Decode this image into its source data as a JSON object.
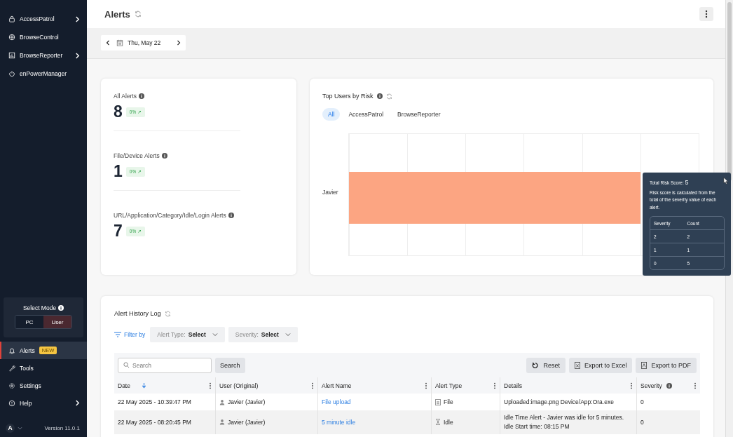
{
  "sidebar": {
    "top_items": [
      {
        "label": "AccessPatrol",
        "kind": "lock",
        "has_submenu": true
      },
      {
        "label": "BrowseControl",
        "kind": "globe",
        "has_submenu": false
      },
      {
        "label": "BrowseReporter",
        "kind": "report",
        "has_submenu": true
      },
      {
        "label": "enPowerManager",
        "kind": "power",
        "has_submenu": false
      }
    ],
    "select_mode": {
      "label": "Select Mode",
      "options": [
        {
          "label": "PC",
          "selected": false
        },
        {
          "label": "User",
          "selected": true
        }
      ]
    },
    "bottom_items": [
      {
        "label": "Alerts",
        "kind": "bell",
        "selected": true,
        "badge": "NEW",
        "has_submenu": false
      },
      {
        "label": "Tools",
        "kind": "wrench",
        "selected": false,
        "has_submenu": false
      },
      {
        "label": "Settings",
        "kind": "gear",
        "selected": false,
        "has_submenu": false
      },
      {
        "label": "Help",
        "kind": "alert",
        "selected": false,
        "has_submenu": true
      }
    ],
    "account": {
      "initial": "A"
    },
    "version": "Version 11.0.1"
  },
  "header": {
    "title": "Alerts"
  },
  "date_nav": {
    "date": "Thu, May 22"
  },
  "stats": [
    {
      "label": "All Alerts",
      "value": "8",
      "change": "0% ↗"
    },
    {
      "label": "File/Device Alerts",
      "value": "1",
      "change": "0% ↗"
    },
    {
      "label": "URL/Application/Category/Idle/Login Alerts",
      "value": "7",
      "change": "0% ↗"
    }
  ],
  "risk": {
    "title": "Top Users by Risk",
    "tabs": [
      {
        "label": "All",
        "selected": true
      },
      {
        "label": "AccessPatrol",
        "selected": false
      },
      {
        "label": "BrowseReporter",
        "selected": false
      }
    ],
    "bars": [
      {
        "user": "Javier",
        "level": 0.8333
      }
    ],
    "tooltip": {
      "title": "Total Risk Score:",
      "score": "5",
      "description": "Risk score is calculated from the total of the severity value of each alert.",
      "columns": [
        "Severity",
        "Count"
      ],
      "rows": [
        [
          "2",
          "2"
        ],
        [
          "1",
          "1"
        ],
        [
          "0",
          "5"
        ]
      ]
    }
  },
  "history": {
    "title": "Alert History Log",
    "filter_label": "Filter by",
    "filters": [
      {
        "label": "Alert Type:",
        "value": "Select"
      },
      {
        "label": "Severity:",
        "value": "Select"
      }
    ],
    "search": {
      "placeholder": "Search"
    },
    "search_button": "Search",
    "actions": [
      {
        "label": "Reset",
        "kind": "reset"
      },
      {
        "label": "Export to Excel",
        "kind": "excel"
      },
      {
        "label": "Export to PDF",
        "kind": "pdf"
      }
    ],
    "columns": [
      {
        "label": "Date",
        "sorted": true,
        "info": false
      },
      {
        "label": "User (Original)",
        "sorted": false,
        "info": false
      },
      {
        "label": "Alert Name",
        "sorted": false,
        "info": false
      },
      {
        "label": "Alert Type",
        "sorted": false,
        "info": false
      },
      {
        "label": "Details",
        "sorted": false,
        "info": false
      },
      {
        "label": "Severity",
        "sorted": false,
        "info": true
      }
    ],
    "rows": [
      {
        "date": "22 May 2025 - 10:39:47 PM",
        "user": "Javier (Javier)",
        "alert_name": "File upload",
        "alert_type": "File",
        "kind": "file",
        "details": "Uploaded:image.png Device/App:Ora.exe",
        "severity": "0"
      },
      {
        "date": "22 May 2025 - 08:20:45 PM",
        "user": "Javier (Javier)",
        "alert_name": "5 minute idle",
        "alert_type": "Idle",
        "kind": "idle",
        "details": "Idle Time Alert - Javier was idle for 5 minutes. Idle Start time: 08:15 PM",
        "severity": "0"
      }
    ]
  }
}
